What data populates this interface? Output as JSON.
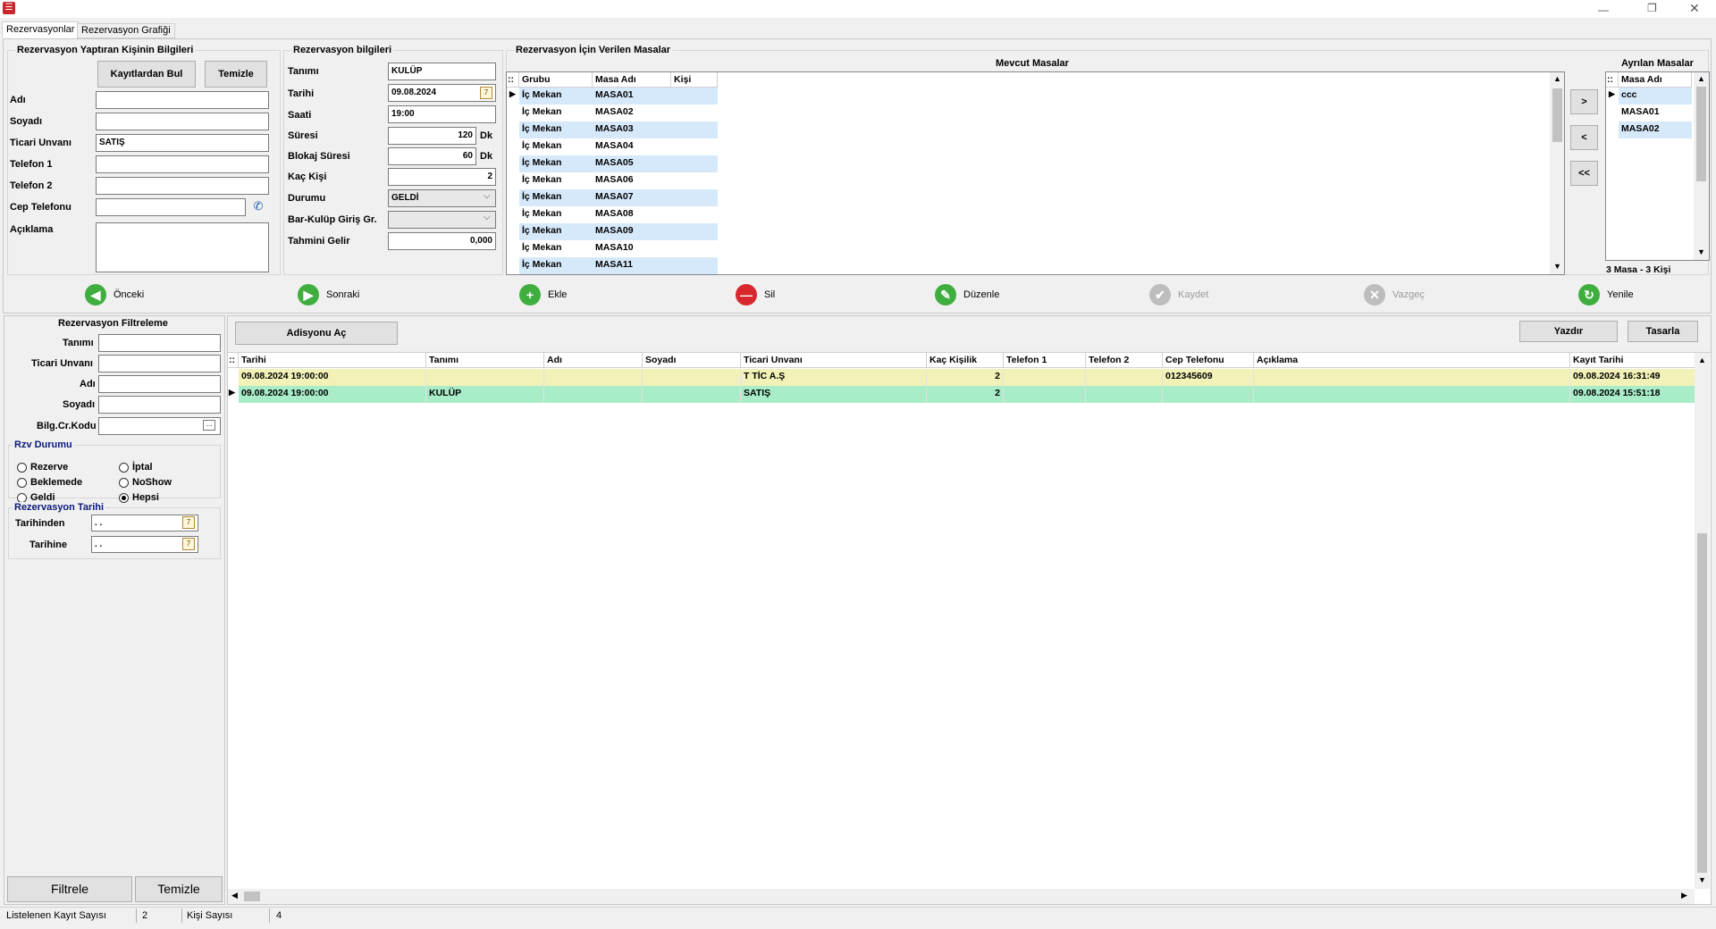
{
  "window": {
    "tabs": [
      "Rezervasyonlar",
      "Rezervasyon Grafiği"
    ]
  },
  "person": {
    "title": "Rezervasyon Yaptıran Kişinin Bilgileri",
    "find_button": "Kayıtlardan Bul",
    "clear_button": "Temizle",
    "labels": {
      "ad": "Adı",
      "soyad": "Soyadı",
      "ticari": "Ticari Unvanı",
      "tel1": "Telefon 1",
      "tel2": "Telefon 2",
      "cep": "Cep Telefonu",
      "aciklama": "Açıklama"
    },
    "values": {
      "ad": "",
      "soyad": "",
      "ticari": "SATIŞ",
      "tel1": "",
      "tel2": "",
      "cep": "",
      "aciklama": ""
    }
  },
  "reservation": {
    "title": "Rezervasyon bilgileri",
    "labels": {
      "tanim": "Tanımı",
      "tarih": "Tarihi",
      "saat": "Saati",
      "sure": "Süresi",
      "blokaj": "Blokaj Süresi",
      "kisi": "Kaç Kişi",
      "durum": "Durumu",
      "bar": "Bar-Kulüp Giriş Gr.",
      "gelir": "Tahmini Gelir"
    },
    "values": {
      "tanim": "KULÜP",
      "tarih": "09.08.2024",
      "saat": "19:00",
      "sure": "120",
      "blokaj": "60",
      "kisi": "2",
      "durum": "GELDİ",
      "bar": "",
      "gelir": "0,000"
    },
    "unit": "Dk"
  },
  "tables": {
    "title": "Rezervasyon İçin Verilen Masalar",
    "available_title": "Mevcut Masalar",
    "assigned_title": "Ayrılan Masalar",
    "available_columns": [
      "Grubu",
      "Masa Adı",
      "Kişi"
    ],
    "available_rows": [
      {
        "grup": "İç Mekan",
        "masa": "MASA01",
        "kisi": ""
      },
      {
        "grup": "İç Mekan",
        "masa": "MASA02",
        "kisi": ""
      },
      {
        "grup": "İç Mekan",
        "masa": "MASA03",
        "kisi": ""
      },
      {
        "grup": "İç Mekan",
        "masa": "MASA04",
        "kisi": ""
      },
      {
        "grup": "İç Mekan",
        "masa": "MASA05",
        "kisi": ""
      },
      {
        "grup": "İç Mekan",
        "masa": "MASA06",
        "kisi": ""
      },
      {
        "grup": "İç Mekan",
        "masa": "MASA07",
        "kisi": ""
      },
      {
        "grup": "İç Mekan",
        "masa": "MASA08",
        "kisi": ""
      },
      {
        "grup": "İç Mekan",
        "masa": "MASA09",
        "kisi": ""
      },
      {
        "grup": "İç Mekan",
        "masa": "MASA10",
        "kisi": ""
      },
      {
        "grup": "İç Mekan",
        "masa": "MASA11",
        "kisi": ""
      }
    ],
    "assigned_column": "Masa Adı",
    "assigned_rows": [
      "ccc",
      "MASA01",
      "MASA02"
    ],
    "move_buttons": [
      ">",
      "<",
      "<<"
    ],
    "summary": "3 Masa - 3 Kişi"
  },
  "toolbar": [
    {
      "label": "Önceki",
      "icon": "arrow-left-icon",
      "color": "#3fae3f"
    },
    {
      "label": "Sonraki",
      "icon": "arrow-right-icon",
      "color": "#3fae3f"
    },
    {
      "label": "Ekle",
      "icon": "plus-icon",
      "color": "#3fae3f"
    },
    {
      "label": "Sil",
      "icon": "minus-icon",
      "color": "#d9272e"
    },
    {
      "label": "Düzenle",
      "icon": "edit-icon",
      "color": "#3fae3f"
    },
    {
      "label": "Kaydet",
      "icon": "check-icon",
      "color": "#bdbdbd"
    },
    {
      "label": "Vazgeç",
      "icon": "cancel-icon",
      "color": "#bdbdbd"
    },
    {
      "label": "Yenile",
      "icon": "refresh-icon",
      "color": "#3fae3f"
    }
  ],
  "filter": {
    "title": "Rezervasyon Filtreleme",
    "labels": {
      "tanim": "Tanımı",
      "ticari": "Ticari Unvanı",
      "ad": "Adı",
      "soyad": "Soyadı",
      "bilg": "Bilg.Cr.Kodu"
    },
    "status_title": "Rzv Durumu",
    "status_options": [
      "Rezerve",
      "İptal",
      "Beklemede",
      "NoShow",
      "Geldi",
      "Hepsi"
    ],
    "status_selected": "Hepsi",
    "date_title": "Rezervasyon Tarihi",
    "date_from_label": "Tarihinden",
    "date_to_label": "Tarihine",
    "date_from": " .  .",
    "date_to": " .  .",
    "filter_button": "Filtrele",
    "clear_button": "Temizle"
  },
  "list": {
    "open_bill_button": "Adisyonu Aç",
    "print_button": "Yazdır",
    "design_button": "Tasarla",
    "columns": [
      "Tarihi",
      "Tanımı",
      "Adı",
      "Soyadı",
      "Ticari Unvanı",
      "Kaç Kişilik",
      "Telefon 1",
      "Telefon 2",
      "Cep Telefonu",
      "Açıklama",
      "Kayıt Tarihi"
    ],
    "rows": [
      {
        "tarih": "09.08.2024 19:00:00",
        "tanim": "",
        "ad": "",
        "soyad": "",
        "ticari": "T TİC A.Ş",
        "kisi": "2",
        "tel1": "",
        "tel2": "",
        "cep": "012345609",
        "aciklama": "",
        "kayit": "09.08.2024 16:31:49",
        "color": "#f2f2b8"
      },
      {
        "tarih": "09.08.2024 19:00:00",
        "tanim": "KULÜP",
        "ad": "",
        "soyad": "",
        "ticari": "SATIŞ",
        "kisi": "2",
        "tel1": "",
        "tel2": "",
        "cep": "",
        "aciklama": "",
        "kayit": "09.08.2024 15:51:18",
        "color": "#a8ecc8"
      }
    ]
  },
  "status_bar": {
    "count_label": "Listelenen Kayıt Sayısı",
    "count": "2",
    "people_label": "Kişi Sayısı",
    "people": "4"
  }
}
